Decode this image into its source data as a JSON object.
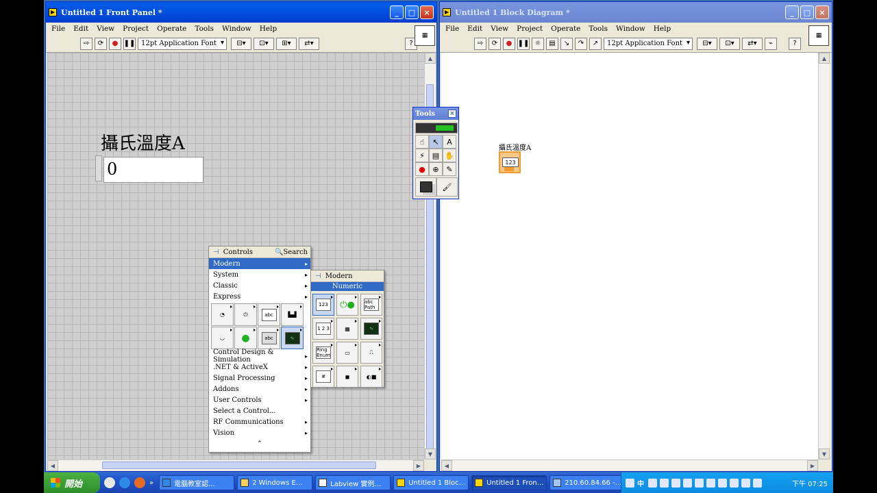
{
  "front_panel": {
    "title": "Untitled 1 Front Panel *",
    "menu": [
      "File",
      "Edit",
      "View",
      "Project",
      "Operate",
      "Tools",
      "Window",
      "Help"
    ],
    "font_selector": "12pt Application Font",
    "help_label": "?",
    "control": {
      "label": "攝氏溫度A",
      "value": "0"
    }
  },
  "block_diagram": {
    "title": "Untitled 1 Block Diagram *",
    "menu": [
      "File",
      "Edit",
      "View",
      "Project",
      "Operate",
      "Tools",
      "Window",
      "Help"
    ],
    "font_selector": "12pt Application Font",
    "help_label": "?",
    "terminal": {
      "label": "攝氏溫度A",
      "text": "123",
      "tag": "DBL"
    }
  },
  "tools_palette": {
    "title": "Tools"
  },
  "controls_palette": {
    "title": "Controls",
    "search_label": "Search",
    "top_items": [
      "Modern",
      "System",
      "Classic",
      "Express"
    ],
    "bottom_items": [
      "Control Design & Simulation",
      ".NET & ActiveX",
      "Signal Processing",
      "Addons",
      "User Controls",
      "Select a Control...",
      "RF Communications",
      "Vision"
    ],
    "icon_labels": [
      "abc"
    ],
    "submenu": {
      "title": "Modern",
      "category": "Numeric",
      "cells": [
        "123",
        "",
        "abc Path",
        "1 2 3",
        "",
        "",
        "Ring Enum",
        "",
        "",
        "#",
        "",
        ""
      ]
    }
  },
  "taskbar": {
    "start_label": "開始",
    "tasks": [
      "電腦教室認...",
      "2 Windows E...",
      "Labview 實例...",
      "Untitled 1 Bloc...",
      "Untitled 1 Fron...",
      "210.60.84.66 -..."
    ],
    "ime": "中",
    "clock": "下午 07:25"
  },
  "colors": {
    "titlebar_active": "#0052e0",
    "numeric_terminal": "#f29b2c",
    "selection": "#316ac5",
    "taskbar": "#1f4fc4",
    "start_button": "#2f8e2a"
  }
}
